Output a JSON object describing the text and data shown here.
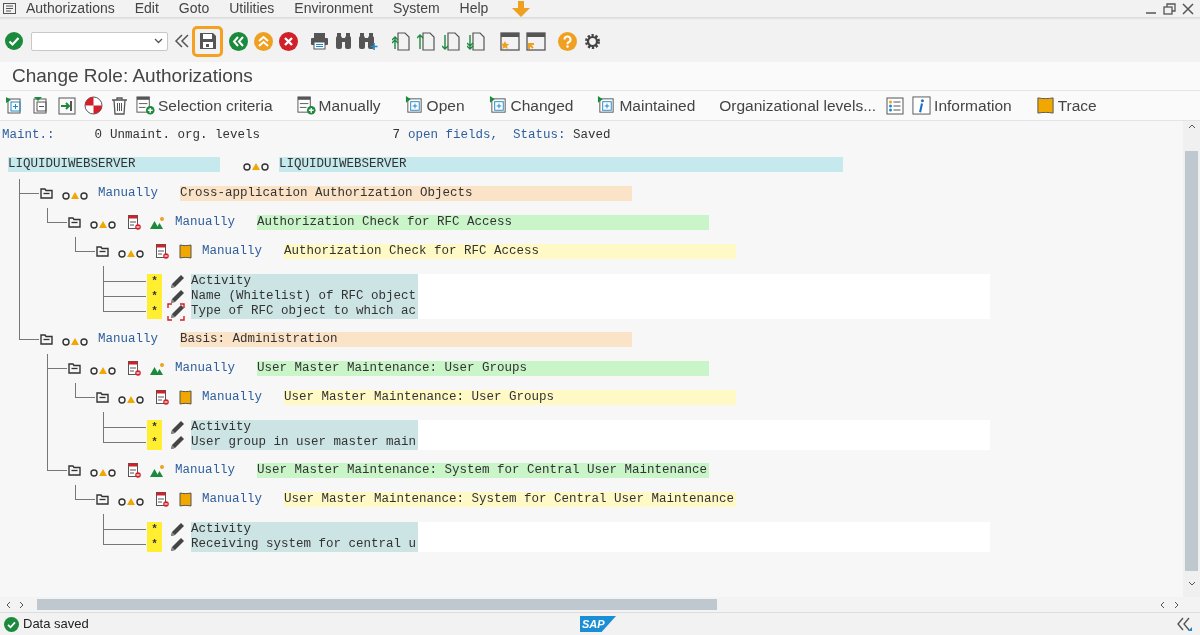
{
  "menu": [
    {
      "label": "Authorizations"
    },
    {
      "label": "Edit"
    },
    {
      "label": "Goto"
    },
    {
      "label": "Utilities"
    },
    {
      "label": "Environment"
    },
    {
      "label": "System"
    },
    {
      "label": "Help"
    }
  ],
  "toolbar": {
    "save_highlighted": true
  },
  "title": "Change Role: Authorizations",
  "app_toolbar": [
    {
      "label": "Selection criteria"
    },
    {
      "label": "Manually"
    },
    {
      "label": "Open"
    },
    {
      "label": "Changed"
    },
    {
      "label": "Maintained"
    },
    {
      "label": "Organizational levels..."
    },
    {
      "label": "Information"
    },
    {
      "label": "Trace"
    }
  ],
  "status_info": [
    {
      "text": "Maint.:",
      "kind": "label"
    },
    {
      "text": "0",
      "kind": "value"
    },
    {
      "text": "Unmaint. org. levels",
      "kind": "value"
    },
    {
      "text": "7",
      "kind": "value"
    },
    {
      "text": "open fields,",
      "kind": "label"
    },
    {
      "text": "Status:",
      "kind": "label"
    },
    {
      "text": "Saved",
      "kind": "value"
    }
  ],
  "tree": {
    "kind": "root",
    "label": "LIQUIDUIWEBSERVER",
    "description": "LIQUIDUIWEBSERVER",
    "children": [
      {
        "kind": "class",
        "status": "Manually",
        "label": "Cross-application Authorization Objects",
        "children": [
          {
            "kind": "object",
            "status": "Manually",
            "label": "Authorization Check for RFC Access",
            "children": [
              {
                "kind": "authorization",
                "status": "Manually",
                "label": "Authorization Check for RFC Access",
                "children": [
                  {
                    "kind": "field",
                    "value": "*",
                    "label": "Activity",
                    "focused": false
                  },
                  {
                    "kind": "field",
                    "value": "*",
                    "label": "Name (Whitelist) of RFC object",
                    "focused": false
                  },
                  {
                    "kind": "field",
                    "value": "*",
                    "label": "Type of RFC object to which ac",
                    "focused": true
                  }
                ]
              }
            ]
          }
        ]
      },
      {
        "kind": "class",
        "status": "Manually",
        "label": "Basis: Administration",
        "children": [
          {
            "kind": "object",
            "status": "Manually",
            "label": "User Master Maintenance: User Groups",
            "children": [
              {
                "kind": "authorization",
                "status": "Manually",
                "label": "User Master Maintenance: User Groups",
                "children": [
                  {
                    "kind": "field",
                    "value": "*",
                    "label": "Activity",
                    "focused": false
                  },
                  {
                    "kind": "field",
                    "value": "*",
                    "label": "User group in user master main",
                    "focused": false
                  }
                ]
              }
            ]
          },
          {
            "kind": "object",
            "status": "Manually",
            "label": "User Master Maintenance: System for Central User Maintenance",
            "children": [
              {
                "kind": "authorization",
                "status": "Manually",
                "label": "User Master Maintenance: System for Central User Maintenance",
                "children": [
                  {
                    "kind": "field",
                    "value": "*",
                    "label": "Activity",
                    "focused": false
                  },
                  {
                    "kind": "field",
                    "value": "*",
                    "label": "Receiving system for central u",
                    "focused": false
                  }
                ]
              }
            ]
          }
        ]
      }
    ]
  },
  "status_bar": {
    "message": "Data saved",
    "logo": "SAP"
  }
}
